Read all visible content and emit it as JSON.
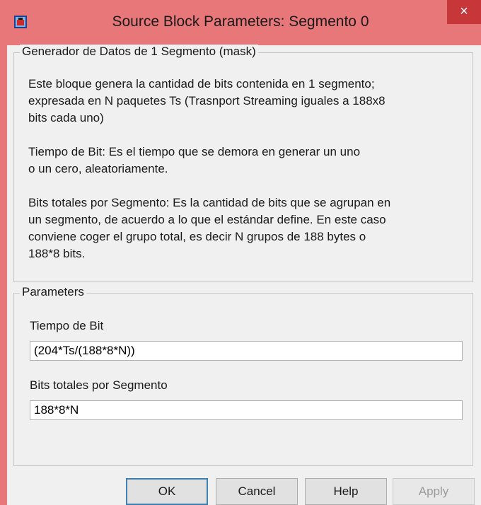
{
  "window": {
    "title": "Source Block Parameters: Segmento 0",
    "close_glyph": "×",
    "colors": {
      "titlebar": "#e8777a",
      "close_button": "#c7373a",
      "client": "#f0f0f0"
    }
  },
  "mask": {
    "group_title": "Generador de Datos de 1 Segmento (mask)",
    "paragraphs": [
      "Este bloque genera la cantidad de bits contenida en 1 segmento;\nexpresada en N paquetes Ts (Trasnport Streaming iguales a 188x8\nbits cada uno)",
      "Tiempo de Bit: Es el tiempo que se demora en generar un uno\no un cero, aleatoriamente.",
      "Bits totales por Segmento: Es la cantidad de bits que se agrupan en\nun segmento, de acuerdo a lo que el estándar define. En este caso\nconviene coger el grupo total, es decir N grupos de 188 bytes o\n188*8 bits."
    ]
  },
  "parameters": {
    "group_title": "Parameters",
    "fields": [
      {
        "label": "Tiempo de Bit",
        "value": "(204*Ts/(188*8*N))"
      },
      {
        "label": "Bits totales por Segmento",
        "value": "188*8*N"
      }
    ]
  },
  "buttons": {
    "ok": "OK",
    "cancel": "Cancel",
    "help": "Help",
    "apply": "Apply"
  }
}
